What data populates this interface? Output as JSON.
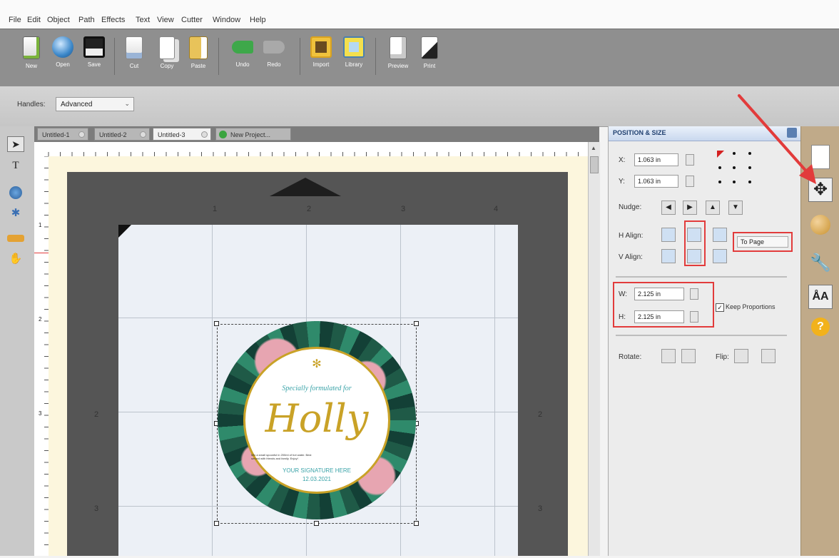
{
  "menu": [
    "File",
    "Edit",
    "Object",
    "Path",
    "Effects",
    "Text",
    "View",
    "Cutter",
    "Window",
    "Help"
  ],
  "toolbar": {
    "buttons": [
      {
        "label": "New",
        "icon": "new-document-icon"
      },
      {
        "label": "Open",
        "icon": "open-globe-icon"
      },
      {
        "label": "Save",
        "icon": "save-disk-icon"
      },
      {
        "label": "Cut",
        "icon": "cut-icon"
      },
      {
        "label": "Copy",
        "icon": "copy-icon"
      },
      {
        "label": "Paste",
        "icon": "paste-icon"
      },
      {
        "label": "Undo",
        "icon": "undo-icon"
      },
      {
        "label": "Redo",
        "icon": "redo-icon"
      },
      {
        "label": "Import",
        "icon": "import-icon"
      },
      {
        "label": "Library",
        "icon": "library-icon"
      },
      {
        "label": "Preview",
        "icon": "preview-icon"
      },
      {
        "label": "Print",
        "icon": "print-icon"
      }
    ]
  },
  "handles": {
    "label": "Handles:",
    "value": "Advanced"
  },
  "tabs": [
    "Untitled-1",
    "Untitled-2",
    "Untitled-3",
    "New Project..."
  ],
  "ruler": {
    "top": [
      "1",
      "2",
      "3",
      "4"
    ],
    "left": [
      "1",
      "2",
      "3"
    ]
  },
  "mat": {
    "numbers": [
      "1",
      "2",
      "3",
      "4",
      "2",
      "3",
      "2",
      "3"
    ]
  },
  "design": {
    "small_text": "Specially formulated for",
    "name": "Holly",
    "fine_print_left": "Mix a small spoonful in 200ml of hot water. Best served with friends and family. Enjoy!",
    "footer_line1": "YOUR SIGNATURE HERE",
    "footer_line2": "12.03.2021"
  },
  "panel": {
    "title": "POSITION & SIZE",
    "x_label": "X:",
    "x_value": "1.063 in",
    "y_label": "Y:",
    "y_value": "1.063 in",
    "nudge_label": "Nudge:",
    "halign_label": "H Align:",
    "valign_label": "V Align:",
    "to_page": "To Page",
    "w_label": "W:",
    "w_value": "2.125 in",
    "h_label": "H:",
    "h_value": "2.125 in",
    "keep_proportions": "Keep Proportions",
    "rotate_label": "Rotate:",
    "flip_label": "Flip:"
  },
  "colors": {
    "annotation_red": "#e23b3b",
    "mat": "#555555",
    "toolbar": "#8f8f8f",
    "side_strip": "#c0aa89"
  }
}
